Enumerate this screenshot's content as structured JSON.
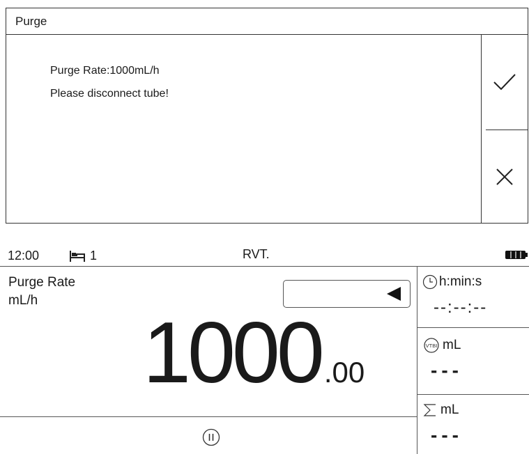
{
  "dialog": {
    "title": "Purge",
    "rate_line": "Purge Rate:1000mL/h",
    "instruction": "Please disconnect tube!",
    "confirm_icon": "check-icon",
    "cancel_icon": "close-icon"
  },
  "status": {
    "time": "12:00",
    "bed": "1",
    "mode": "RVT.",
    "battery_level": 1.0
  },
  "main": {
    "param_name": "Purge Rate",
    "param_unit": "mL/h",
    "value_int": "1000",
    "value_dec": ".00"
  },
  "panels": [
    {
      "icon": "clock-icon",
      "label": "h:min:s",
      "value": "--:--:--"
    },
    {
      "icon": "vtbi-icon",
      "icon_text": "VTBI",
      "label": "mL",
      "value": "---"
    },
    {
      "icon": "sigma-icon",
      "label": "mL",
      "value": "---"
    }
  ]
}
